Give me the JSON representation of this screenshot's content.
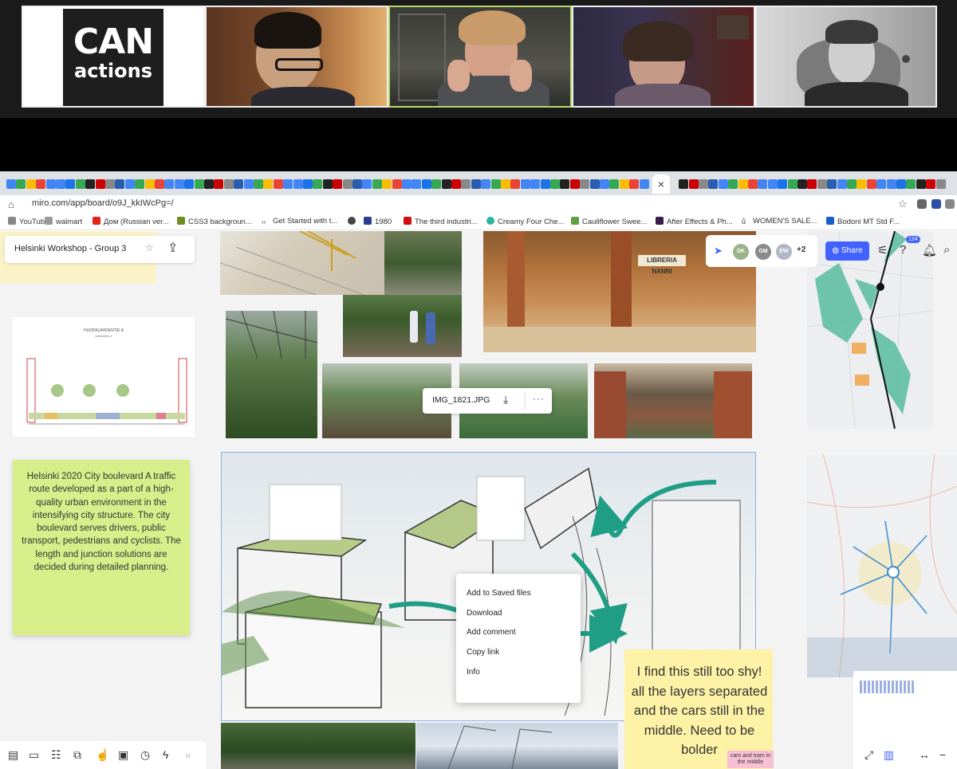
{
  "video_call": {
    "logo_line1": "CAN",
    "logo_line2": "actions"
  },
  "browser": {
    "tab_close": "×",
    "url": "miro.com/app/board/o9J_kkIWcPg=/",
    "bookmarks": [
      "YouTube",
      "walmart",
      "Дом (Russian ver...",
      "CSS3 backgroun...",
      "Get Started with t...",
      "1980",
      "The third industri...",
      "Creamy Four Che...",
      "Cauliflower Swee...",
      "After Effects & Ph...",
      "WOMEN'S SALE...",
      "Bodoni MT Std F..."
    ]
  },
  "board": {
    "title": "Helsinki Workshop - Group 3",
    "share_label": "Share",
    "notification_count": "124",
    "collaborators": [
      "DK",
      "GM",
      "EW"
    ],
    "collaborators_more": "+2",
    "section_label": "HUOPALAHDENTIE A",
    "section_sublabel": "vaihtoehto 1",
    "image_toolbar": {
      "filename": "IMG_1821.JPG",
      "more": "···"
    },
    "context_menu": [
      "Add to Saved files",
      "Download",
      "Add comment",
      "Copy link",
      "Info"
    ],
    "sticky_green": "Helsinki 2020 City boulevard A traffic route developed as a part of a high-quality urban environment in the intensifying city structure. The city boulevard serves drivers, public transport, pedestrians and cyclists. The length and junction solutions are decided during detailed planning.",
    "sticky_yellow": "I find this still too shy! all the layers separated and the cars still in the middle. Need to be bolder",
    "sticky_pink": "cars and tram in the middle",
    "photo_sign": "LIBRERIA NANNI"
  },
  "colors": {
    "accent": "#4262ff",
    "teal_arrow": "#1f9e85",
    "sticky_green": "#d8ee8a",
    "sticky_yellow": "#fdf2a6"
  }
}
